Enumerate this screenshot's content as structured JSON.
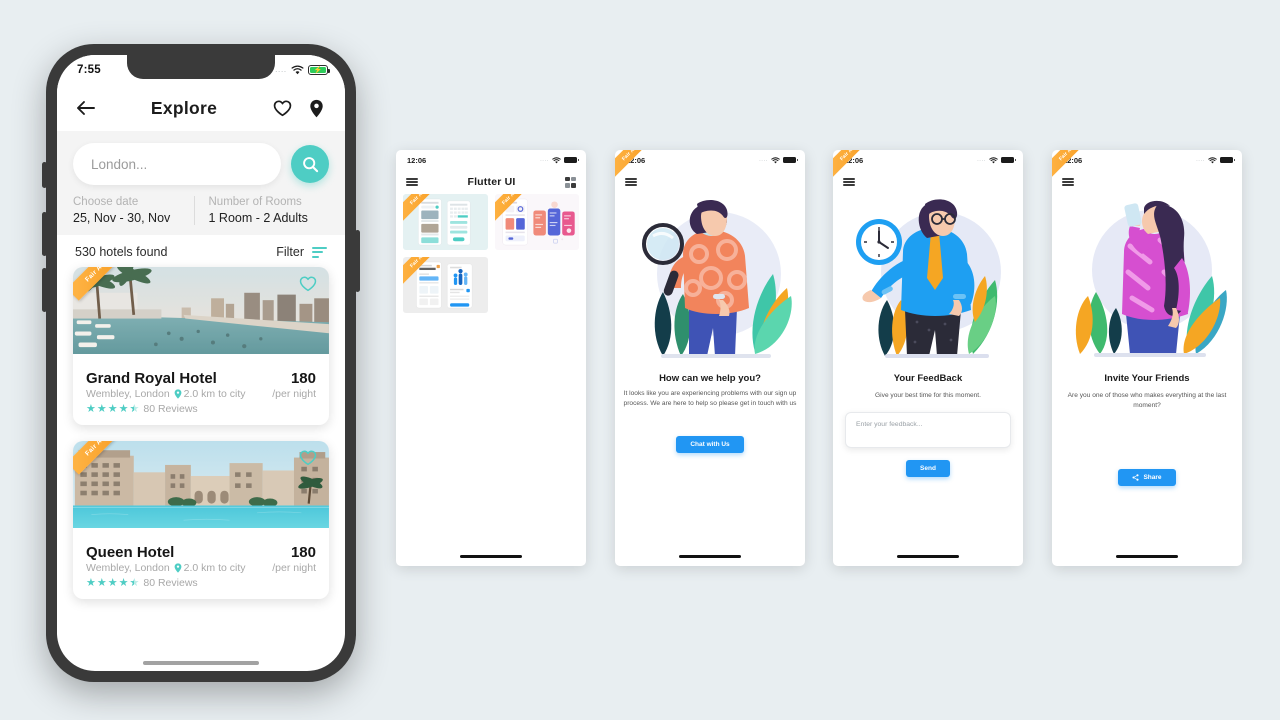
{
  "background_color": "#e8eef1",
  "accent_teal": "#4ecdc4",
  "accent_blue": "#2196f3",
  "ribbon_color": "#f79a1f",
  "ribbon_label": "Fair Asset",
  "main_phone": {
    "status_bar": {
      "time": "7:55",
      "dots": "....",
      "wifi_icon": "wifi-icon",
      "battery_icon": "battery-charging-icon"
    },
    "app_bar": {
      "back_icon": "arrow-left-icon",
      "title": "Explore",
      "favorite_icon": "heart-icon",
      "location_icon": "map-pin-icon"
    },
    "search": {
      "placeholder": "London...",
      "value": "London...",
      "search_icon": "search-icon"
    },
    "filters": {
      "date_label": "Choose date",
      "date_value": "25, Nov - 30, Nov",
      "rooms_label": "Number of Rooms",
      "rooms_value": "1 Room - 2 Adults"
    },
    "results": {
      "count_text": "530 hotels found",
      "filter_label": "Filter",
      "filter_icon": "filter-lines-icon"
    },
    "hotels": [
      {
        "ribbon": "Fair Asset",
        "name": "Grand Royal Hotel",
        "location": "Wembley, London",
        "distance": "2.0 km to city",
        "price": "180",
        "per": "/per night",
        "rating": 4.5,
        "reviews": "80 Reviews",
        "favorite_icon": "heart-outline-icon",
        "image_name": "infinity-pool-city-skyline-photo"
      },
      {
        "ribbon": "Fair Asset",
        "name": "Queen Hotel",
        "location": "Wembley, London",
        "distance": "2.0 km to city",
        "price": "180",
        "per": "/per night",
        "rating": 4.5,
        "reviews": "80 Reviews",
        "favorite_icon": "heart-outline-icon",
        "image_name": "sandstone-resort-lagoon-photo"
      }
    ]
  },
  "screens": [
    {
      "id": "flutter-ui-gallery",
      "status_time": "12:06",
      "menu_icon": "hamburger-icon",
      "title": "Flutter UI",
      "grid_icon": "grid-view-icon",
      "thumbnails": [
        {
          "ribbon": "Fair Asset",
          "name": "hotel-booking-ui-thumbnail"
        },
        {
          "ribbon": "Fair Asset",
          "name": "fitness-cards-ui-thumbnail"
        },
        {
          "ribbon": "Fair Asset",
          "name": "course-dashboard-ui-thumbnail"
        }
      ]
    },
    {
      "id": "help-screen",
      "status_time": "12:06",
      "ribbon": "Fair Asset",
      "menu_icon": "hamburger-icon",
      "illustration": "man-with-magnifying-glass-illustration",
      "heading": "How can we help you?",
      "body": "It looks like you are experiencing problems with our sign up process. We are here to help so please get in touch with us",
      "button_label": "Chat with Us"
    },
    {
      "id": "feedback-screen",
      "status_time": "12:06",
      "ribbon": "Fair Asset",
      "menu_icon": "hamburger-icon",
      "illustration": "man-with-clock-illustration",
      "heading": "Your FeedBack",
      "body": "Give your best time for this moment.",
      "input_placeholder": "Enter your feedback...",
      "button_label": "Send"
    },
    {
      "id": "invite-screen",
      "status_time": "12:06",
      "ribbon": "Fair Asset",
      "menu_icon": "hamburger-icon",
      "illustration": "woman-with-phone-illustration",
      "heading": "Invite Your Friends",
      "body": "Are you one of those who makes everything at the last moment?",
      "button_label": "Share",
      "button_icon": "share-icon"
    }
  ]
}
